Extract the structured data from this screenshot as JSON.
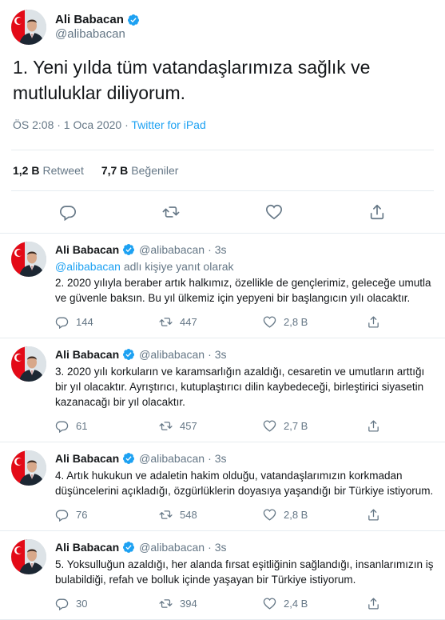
{
  "main_tweet": {
    "name": "Ali Babacan",
    "handle": "@alibabacan",
    "text": "1. Yeni yılda tüm vatandaşlarımıza sağlık ve mutluluklar diliyorum.",
    "time": "ÖS 2:08 · 1 Oca 2020 · ",
    "source": "Twitter for iPad",
    "retweets_count": "1,2 B",
    "retweets_label": "Retweet",
    "likes_count": "7,7 B",
    "likes_label": "Beğeniler",
    "icons": [
      "reply-icon",
      "retweet-icon",
      "like-icon",
      "share-icon"
    ]
  },
  "replies": [
    {
      "name": "Ali Babacan",
      "handle": "@alibabacan",
      "dot": "·",
      "time": "3s",
      "reply_to_mention": "@alibabacan",
      "reply_to_text": " adlı kişiye yanıt olarak",
      "text": "2. 2020 yılıyla beraber artık halkımız, özellikle de gençlerimiz, geleceğe umutla ve güvenle baksın. Bu yıl ülkemiz için yepyeni bir başlangıcın yılı olacaktır.",
      "replies": "144",
      "retweets": "447",
      "likes": "2,8 B"
    },
    {
      "name": "Ali Babacan",
      "handle": "@alibabacan",
      "dot": "·",
      "time": "3s",
      "text": "3. 2020 yılı korkuların ve karamsarlığın azaldığı, cesaretin ve umutların arttığı bir yıl olacaktır. Ayrıştırıcı, kutuplaştırıcı dilin kaybedeceği, birleştirici siyasetin kazanacağı bir yıl olacaktır.",
      "replies": "61",
      "retweets": "457",
      "likes": "2,7 B"
    },
    {
      "name": "Ali Babacan",
      "handle": "@alibabacan",
      "dot": "·",
      "time": "3s",
      "text": "4. Artık hukukun ve adaletin hakim olduğu, vatandaşlarımızın korkmadan düşüncelerini açıkladığı, özgürlüklerin doyasıya yaşandığı bir Türkiye istiyorum.",
      "replies": "76",
      "retweets": "548",
      "likes": "2,8 B"
    },
    {
      "name": "Ali Babacan",
      "handle": "@alibabacan",
      "dot": "·",
      "time": "3s",
      "text": "5. Yoksulluğun azaldığı, her alanda fırsat eşitliğinin sağlandığı, insanlarımızın iş bulabildiği, refah ve bolluk içinde yaşayan bir Türkiye istiyorum.",
      "replies": "30",
      "retweets": "394",
      "likes": "2,4 B"
    }
  ],
  "colors": {
    "accent": "#1da1f2",
    "muted": "#657786",
    "text": "#14171a",
    "border": "#e6ecf0",
    "verified": "#1da1f2",
    "flag_red": "#e30a17"
  }
}
